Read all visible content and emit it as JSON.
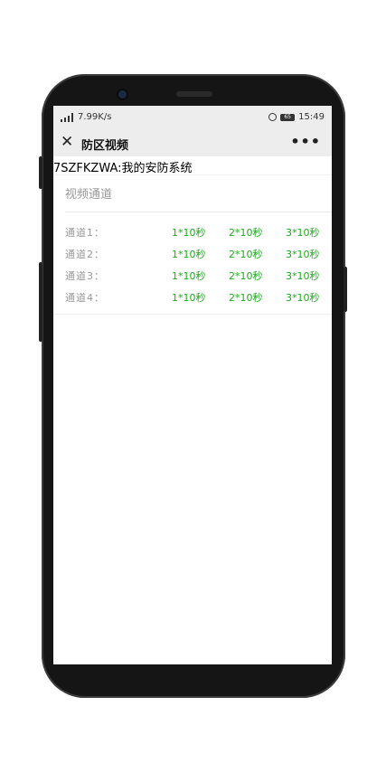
{
  "status_bar": {
    "network": "7.99K/s",
    "battery": "65",
    "time": "15:49"
  },
  "nav": {
    "title": "防区视频"
  },
  "device_title": "7SZFKZWA:我的安防系统",
  "section_label": "视频通道",
  "channels": [
    {
      "label": "通道1：",
      "buttons": [
        "1*10秒",
        "2*10秒",
        "3*10秒"
      ]
    },
    {
      "label": "通道2：",
      "buttons": [
        "1*10秒",
        "2*10秒",
        "3*10秒"
      ]
    },
    {
      "label": "通道3：",
      "buttons": [
        "1*10秒",
        "2*10秒",
        "3*10秒"
      ]
    },
    {
      "label": "通道4：",
      "buttons": [
        "1*10秒",
        "2*10秒",
        "3*10秒"
      ]
    }
  ],
  "colors": {
    "accent": "#1aad19",
    "muted": "#999999",
    "nav_bg": "#ededed"
  },
  "icons": [
    "close-icon",
    "more-icon",
    "alarm-icon",
    "battery-icon",
    "signal-icon"
  ]
}
